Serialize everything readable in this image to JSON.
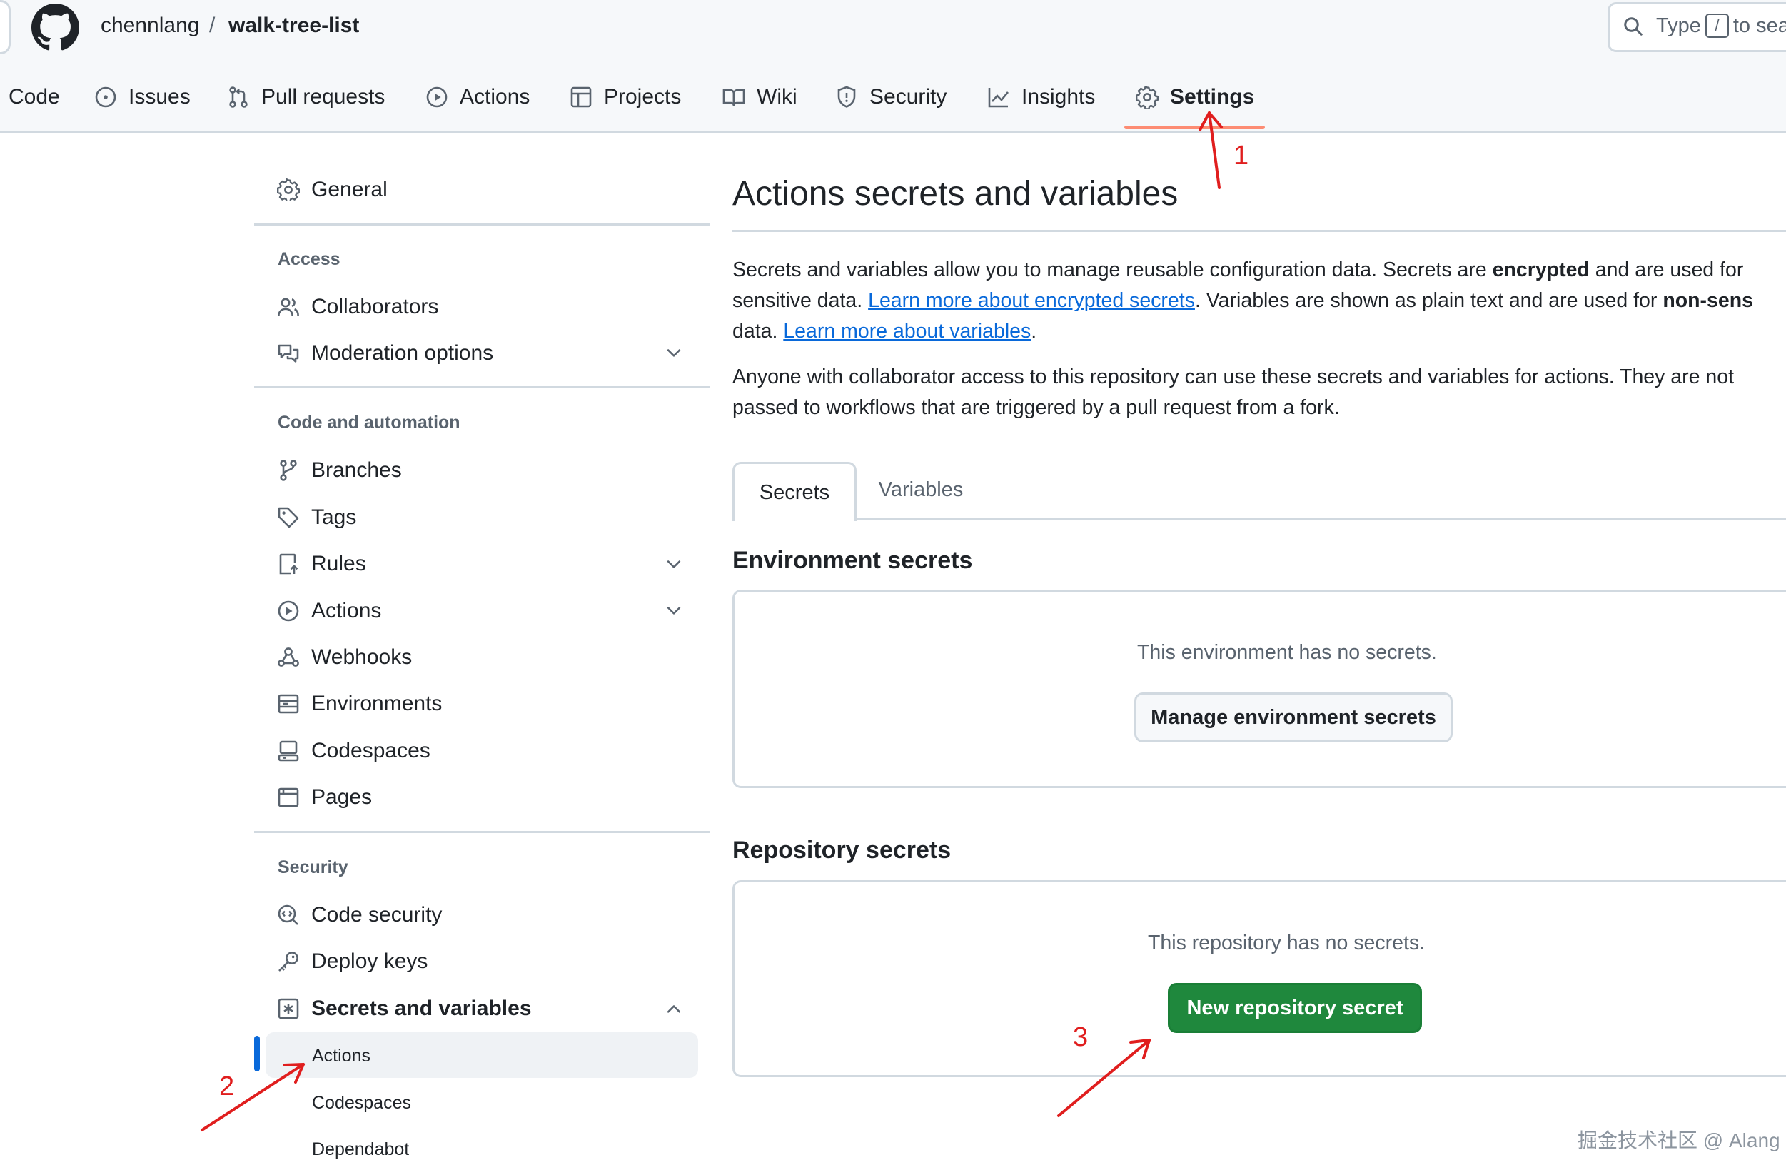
{
  "header": {
    "owner": "chennlang",
    "separator": "/",
    "repo": "walk-tree-list",
    "search_prefix": "Type",
    "search_key": "/",
    "search_suffix": "to sea"
  },
  "repo_tabs": [
    {
      "label": "Code",
      "icon": "code-icon"
    },
    {
      "label": "Issues",
      "icon": "issue-opened-icon"
    },
    {
      "label": "Pull requests",
      "icon": "git-pull-request-icon"
    },
    {
      "label": "Actions",
      "icon": "play-icon"
    },
    {
      "label": "Projects",
      "icon": "table-icon"
    },
    {
      "label": "Wiki",
      "icon": "book-icon"
    },
    {
      "label": "Security",
      "icon": "shield-icon"
    },
    {
      "label": "Insights",
      "icon": "graph-icon"
    },
    {
      "label": "Settings",
      "icon": "gear-icon",
      "selected": true
    }
  ],
  "sidebar": {
    "general": "General",
    "access_heading": "Access",
    "access": [
      "Collaborators",
      "Moderation options"
    ],
    "code_heading": "Code and automation",
    "code": [
      "Branches",
      "Tags",
      "Rules",
      "Actions",
      "Webhooks",
      "Environments",
      "Codespaces",
      "Pages"
    ],
    "security_heading": "Security",
    "security": [
      "Code security",
      "Deploy keys",
      "Secrets and variables"
    ],
    "secrets_sub": [
      "Actions",
      "Codespaces",
      "Dependabot"
    ],
    "active_sub": "Actions"
  },
  "main": {
    "title": "Actions secrets and variables",
    "p1_a": "Secrets and variables allow you to manage reusable configuration data. Secrets are ",
    "p1_b": "encrypted",
    "p1_c": " and are used for",
    "p1_d": "sensitive data. ",
    "p1_link1": "Learn more about encrypted secrets",
    "p1_e": ". Variables are shown as plain text and are used for ",
    "p1_f": "non-sens",
    "p1_g": "data. ",
    "p1_link2": "Learn more about variables",
    "p1_h": ".",
    "p2_line1": "Anyone with collaborator access to this repository can use these secrets and variables for actions. They are not",
    "p2_line2": "passed to workflows that are triggered by a pull request from a fork.",
    "tabs": [
      "Secrets",
      "Variables"
    ],
    "active_tab": "Secrets",
    "env_heading": "Environment secrets",
    "env_empty": "This environment has no secrets.",
    "env_button": "Manage environment secrets",
    "repo_heading": "Repository secrets",
    "repo_empty": "This repository has no secrets.",
    "repo_button": "New repository secret"
  },
  "annotations": [
    "1",
    "2",
    "3"
  ],
  "watermark": "掘金技术社区 @ Alang",
  "colors": {
    "accent_link": "#0969da",
    "primary_button": "#1f883d",
    "tab_underline": "#fd8c73",
    "annotation": "#e01e1e"
  }
}
